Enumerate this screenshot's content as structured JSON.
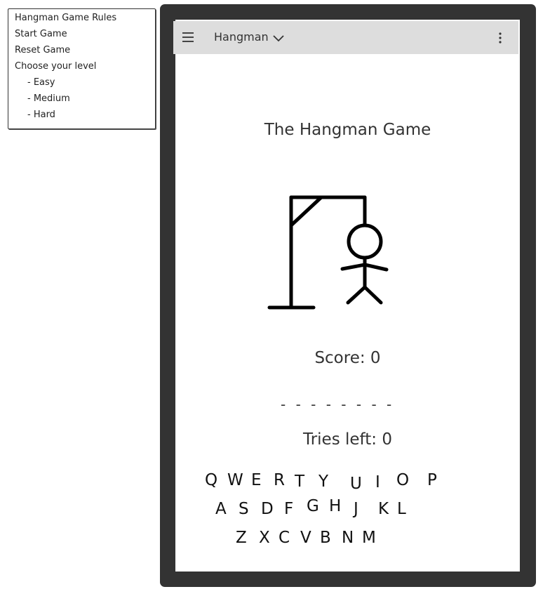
{
  "side_menu": {
    "items": [
      {
        "label": "Hangman Game Rules"
      },
      {
        "label": "Start Game"
      },
      {
        "label": "Reset Game"
      },
      {
        "label": "Choose your level"
      },
      {
        "label": "- Easy"
      },
      {
        "label": "- Medium"
      },
      {
        "label": "- Hard"
      }
    ]
  },
  "appbar": {
    "title": "Hangman",
    "menu_icon": "hamburger-icon",
    "dropdown_icon": "chevron-down-icon",
    "more_icon": "kebab-icon"
  },
  "game": {
    "title": "The Hangman Game",
    "score": "Score: 0",
    "word": "- - - - - - - -",
    "tries": "Tries left: 0"
  },
  "keyboard": {
    "row1": [
      "Q",
      "W",
      "E",
      "R",
      "T",
      "Y",
      "U",
      "I",
      "O",
      "P"
    ],
    "row2": [
      "A",
      "S",
      "D",
      "F",
      "G",
      "H",
      "J",
      "K",
      "L"
    ],
    "row3": [
      "Z",
      "X",
      "C",
      "V",
      "B",
      "N",
      "M"
    ]
  }
}
